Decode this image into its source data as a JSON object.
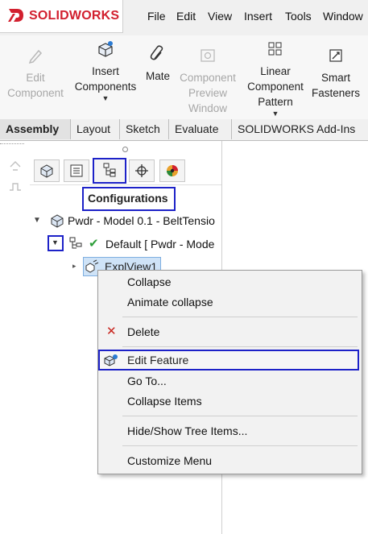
{
  "app": {
    "brand_prefix": "3S",
    "brand_name": "SOLIDWORKS"
  },
  "menu": [
    "File",
    "Edit",
    "View",
    "Insert",
    "Tools",
    "Window"
  ],
  "ribbon": {
    "edit_component": [
      "Edit",
      "Component"
    ],
    "insert_components": [
      "Insert",
      "Components"
    ],
    "mate": [
      "Mate"
    ],
    "preview": [
      "Component",
      "Preview",
      "Window"
    ],
    "linear_pattern": [
      "Linear",
      "Component",
      "Pattern"
    ],
    "smart_fasteners": [
      "Smart",
      "Fasteners"
    ]
  },
  "tabs": [
    "Assembly",
    "Layout",
    "Sketch",
    "Evaluate",
    "SOLIDWORKS Add-Ins"
  ],
  "panel": {
    "title": "Configurations",
    "tree": {
      "root": "Pwdr - Model 0.1 - BeltTensio",
      "config": "Default [ Pwdr - Mode",
      "explode": "ExplView1"
    }
  },
  "context_menu": {
    "items": [
      "Collapse",
      "Animate collapse",
      "Delete",
      "Edit Feature",
      "Go To...",
      "Collapse Items",
      "Hide/Show Tree Items...",
      "Customize Menu"
    ]
  },
  "colors": {
    "highlight": "#1d22c8",
    "brand": "#d2202f",
    "check": "#2e9e3a",
    "delete": "#c8251e"
  }
}
